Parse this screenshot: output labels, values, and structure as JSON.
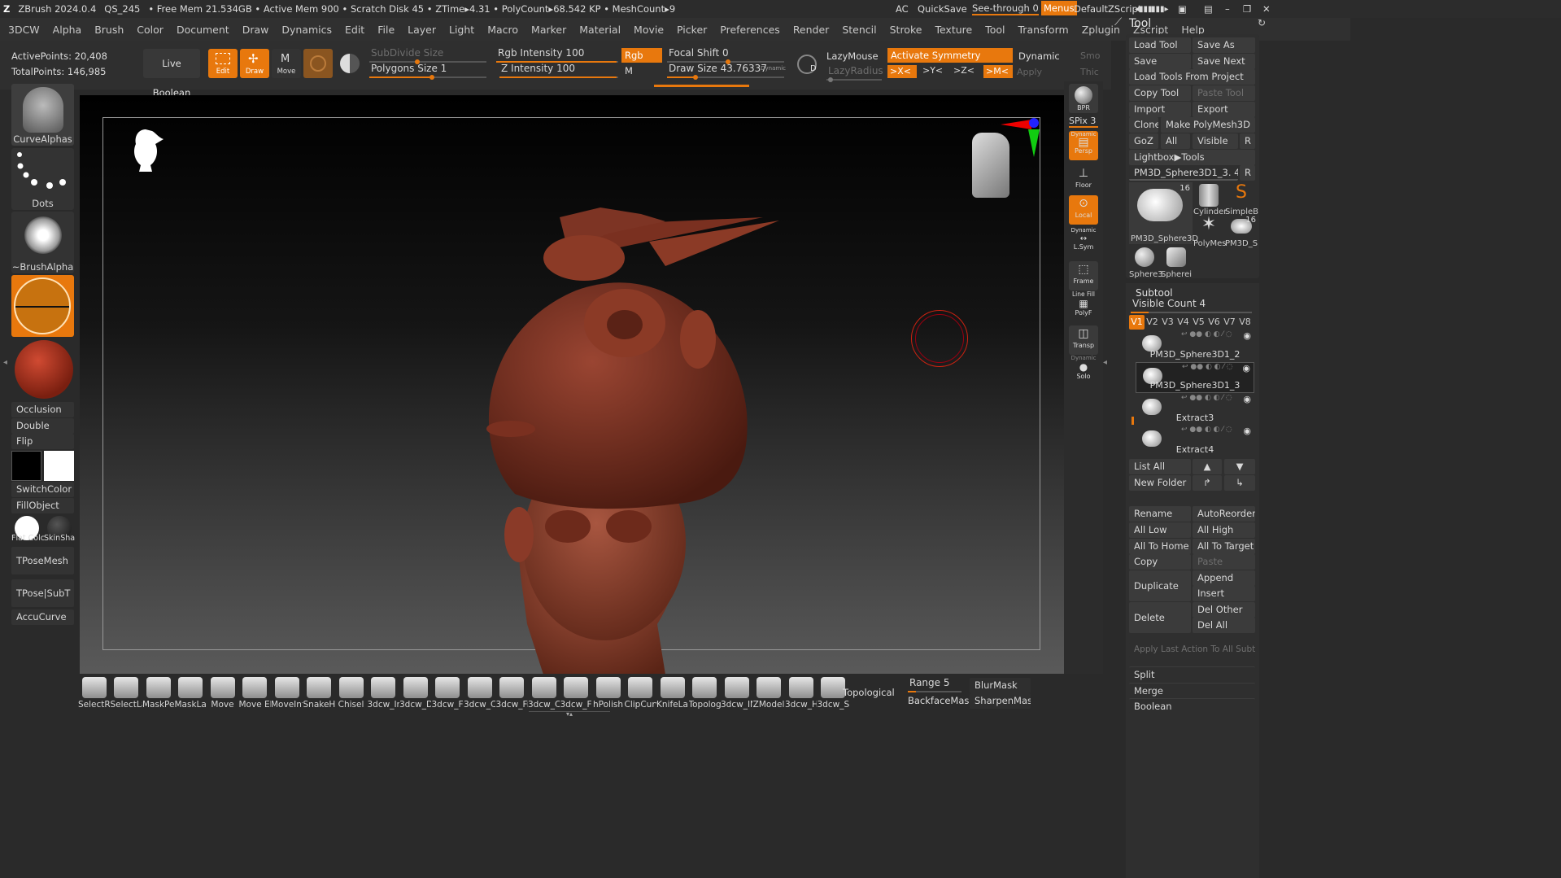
{
  "titlebar": {
    "app": "ZBrush 2024.0.4",
    "doc": "QS_245",
    "freemem": "• Free Mem 21.534GB • Active Mem 900 • Scratch Disk 45 • ZTime▸4.31 • PolyCount▸68.542 KP • MeshCount▸9",
    "ac": "AC",
    "quicksave": "QuickSave",
    "seethrough": "See-through  0",
    "menus": "Menus",
    "defaultzscript": "DefaultZScript"
  },
  "menubar": [
    "3DCW",
    "Alpha",
    "Brush",
    "Color",
    "Document",
    "Draw",
    "Dynamics",
    "Edit",
    "File",
    "Layer",
    "Light",
    "Macro",
    "Marker",
    "Material",
    "Movie",
    "Picker",
    "Preferences",
    "Render",
    "Stencil",
    "Stroke",
    "Texture",
    "Tool",
    "Transform",
    "Zplugin",
    "Zscript",
    "Help"
  ],
  "stats": {
    "active": "ActivePoints: 20,408",
    "total": "TotalPoints: 146,985"
  },
  "toolbar": {
    "live_boolean": "Live Boolean",
    "edit": "Edit",
    "draw": "Draw",
    "move": "Move",
    "subdivide": "SubDivide Size",
    "polygons": "Polygons Size 1",
    "rgb_intensity": "Rgb Intensity 100",
    "z_intensity": "Z Intensity 100",
    "rgb": "Rgb",
    "m": "M",
    "focal": "Focal Shift 0",
    "drawsize": "Draw Size 43.76337",
    "dynamic_small": "Dynamic",
    "lazymouse": "LazyMouse",
    "lazyradius": "LazyRadius",
    "activate_sym": "Activate Symmetry",
    "dynamic": "Dynamic",
    "x": ">X<",
    "y": ">Y<",
    "z": ">Z<",
    "m2": ">M<",
    "apply": "Apply",
    "smo": "Smo",
    "thic": "Thic",
    "d": "D"
  },
  "left": {
    "curvealphas": "CurveAlphas",
    "dots": "Dots",
    "brushalpha": "~BrushAlpha",
    "occlusion": "Occlusion",
    "double": "Double",
    "flip": "Flip",
    "switchcolor": "SwitchColor",
    "fillobject": "FillObject",
    "flatcolor": "Flat Colc",
    "skinshade": "SkinSha",
    "tposemesh": "TPoseMesh",
    "tposesubt": "TPose|SubT",
    "accucurve": "AccuCurve"
  },
  "rightshelf": {
    "bpr": "BPR",
    "spix": "SPix 3",
    "persp": "Persp",
    "dynamic_persp": "Dynamic",
    "floor": "Floor",
    "local": "Local",
    "dynamic_lsym": "Dynamic",
    "lsym": "L.Sym",
    "frame": "Frame",
    "linefill": "Line Fill",
    "polyf": "PolyF",
    "transp": "Transp",
    "dynamic_solo": "Dynamic",
    "solo": "Solo"
  },
  "tool": {
    "title": "Tool",
    "load_tool": "Load Tool",
    "save_as": "Save As",
    "save": "Save",
    "save_next": "Save Next",
    "load_from_project": "Load Tools From Project",
    "copy_tool": "Copy Tool",
    "paste_tool": "Paste Tool",
    "import": "Import",
    "export": "Export",
    "clone": "Clone",
    "make_polymesh": "Make PolyMesh3D",
    "goz": "GoZ",
    "all": "All",
    "visible": "Visible",
    "r": "R",
    "lightbox": "Lightbox▶Tools",
    "current": "PM3D_Sphere3D1_3. 48",
    "r2": "R",
    "thumbs": [
      "PM3D_Sphere3D",
      "Cylinder",
      "SimpleB",
      "PolyMes",
      "PM3D_S",
      "Sphere3",
      "Spherei"
    ],
    "thumb_count1": "16",
    "thumb_count2": "16"
  },
  "subtool": {
    "title": "Subtool",
    "visible_count": "Visible Count 4",
    "versions": [
      "V1",
      "V2",
      "V3",
      "V4",
      "V5",
      "V6",
      "V7",
      "V8"
    ],
    "items": [
      "PM3D_Sphere3D1_2",
      "PM3D_Sphere3D1_3",
      "Extract3",
      "Extract4"
    ],
    "list_all": "List All",
    "new_folder": "New Folder",
    "rename": "Rename",
    "autoreorder": "AutoReorder",
    "all_low": "All Low",
    "all_high": "All High",
    "all_to_home": "All To Home",
    "all_to_target": "All To Target",
    "copy": "Copy",
    "paste": "Paste",
    "duplicate": "Duplicate",
    "append": "Append",
    "insert": "Insert",
    "delete": "Delete",
    "del_other": "Del Other",
    "del_all": "Del All",
    "apply_last": "Apply Last Action To All Subtools",
    "split": "Split",
    "merge": "Merge",
    "boolean": "Boolean"
  },
  "bottom": {
    "tray": [
      "SelectRe",
      "SelectLa",
      "MaskPe",
      "MaskLa",
      "Move",
      "Move El",
      "MoveInf",
      "SnakeH",
      "Chisel",
      "3dcw_In",
      "3dcw_Di",
      "3dcw_Fl",
      "3dcw_Cl",
      "3dcw_Fil",
      "3dcw_Cl",
      "3dcw_Fc",
      "hPolish",
      "ClipCurv",
      "KnifeLas",
      "Topolog",
      "3dcw_IN",
      "ZModel",
      "3dcw_H",
      "3dcw_Sc"
    ],
    "topological": "Topological",
    "range": "Range 5",
    "backfacemask": "BackfaceMask",
    "blurmask": "BlurMask",
    "sharpenmask": "SharpenMask"
  },
  "colors": {
    "accent": "#e8780d",
    "canvas_top": "#000000",
    "canvas_bottom": "#6a6a6a",
    "clay": "#8a3a2a"
  }
}
